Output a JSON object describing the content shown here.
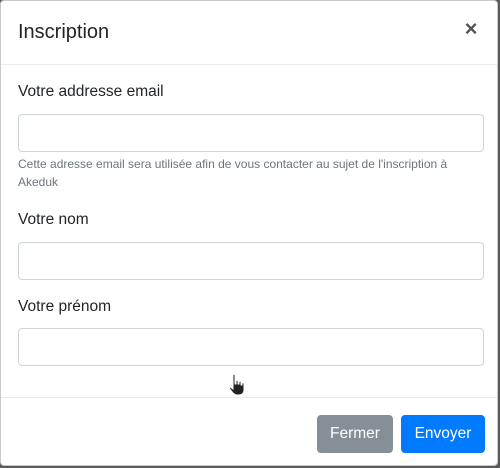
{
  "modal": {
    "title": "Inscription",
    "close_symbol": "×"
  },
  "form": {
    "email": {
      "label": "Votre addresse email",
      "value": "",
      "placeholder": "",
      "help": "Cette adresse email sera utilisée afin de vous contacter au sujet de l'inscription à Akeduk"
    },
    "nom": {
      "label": "Votre nom",
      "value": "",
      "placeholder": ""
    },
    "prenom": {
      "label": "Votre prénom",
      "value": "",
      "placeholder": ""
    }
  },
  "footer": {
    "close_label": "Fermer",
    "submit_label": "Envoyer"
  },
  "colors": {
    "primary": "#007bff",
    "secondary": "#868e96"
  },
  "icons": {
    "close": "close-icon",
    "cursor": "hand-pointer-icon"
  }
}
